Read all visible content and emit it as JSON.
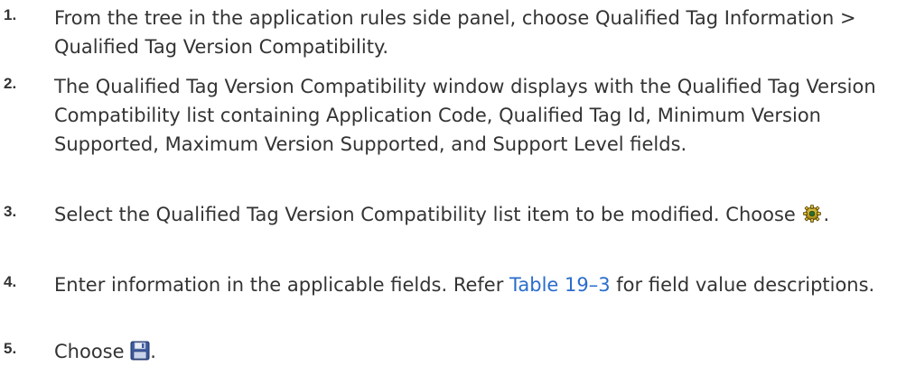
{
  "steps": [
    {
      "number": "1.",
      "text": "From the tree in the application rules side panel, choose Qualified Tag Information > Qualified Tag Version Compatibility."
    },
    {
      "number": "2.",
      "text": "The Qualified Tag Version Compatibility window displays with the Qualified Tag Version Compatibility list containing Application Code, Qualified Tag Id, Minimum Version Supported, Maximum Version Supported, and Support Level fields."
    },
    {
      "number": "3.",
      "text_before": "Select the Qualified Tag Version Compatibility list item to be modified. Choose ",
      "icon": "modify-gear-icon",
      "text_after": "."
    },
    {
      "number": "4.",
      "text_before": "Enter information in the applicable fields. Refer ",
      "link_text": "Table 19–3",
      "text_after": " for field value descriptions."
    },
    {
      "number": "5.",
      "text_before": "Choose ",
      "icon": "save-disk-icon",
      "text_after": "."
    }
  ],
  "colors": {
    "text": "#333333",
    "link": "#2a6dcc"
  }
}
